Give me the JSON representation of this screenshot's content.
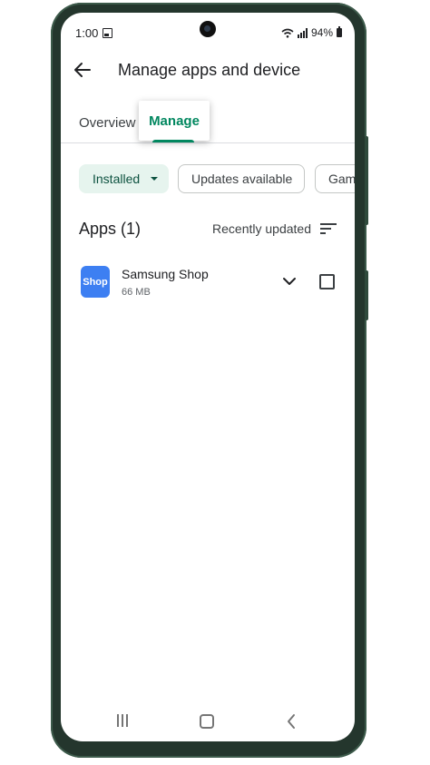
{
  "status_bar": {
    "time": "1:00",
    "battery": "94%",
    "icons": [
      "gallery-icon",
      "wifi-icon",
      "signal-icon",
      "battery-icon"
    ]
  },
  "header": {
    "title": "Manage apps and device",
    "back_icon": "arrow-left-icon"
  },
  "tabs": [
    {
      "label": "Overview",
      "selected": false
    },
    {
      "label": "Manage",
      "selected": true
    }
  ],
  "filters": {
    "installed_label": "Installed",
    "updates_label": "Updates available",
    "games_label": "Games"
  },
  "apps_section": {
    "count_label": "Apps (1)",
    "sort_label": "Recently updated",
    "sort_icon": "sort-icon"
  },
  "apps": [
    {
      "name": "Samsung Shop",
      "size": "66 MB",
      "icon_text": "Shop",
      "checked": false
    }
  ],
  "colors": {
    "accent": "#01875f",
    "chip_selected_bg": "#e6f4ee",
    "app_icon_bg": "#3d7ff2",
    "phone_frame": "#24362d"
  },
  "nav_bar": {
    "icons": [
      "recent-apps-icon",
      "home-icon",
      "back-icon"
    ]
  }
}
